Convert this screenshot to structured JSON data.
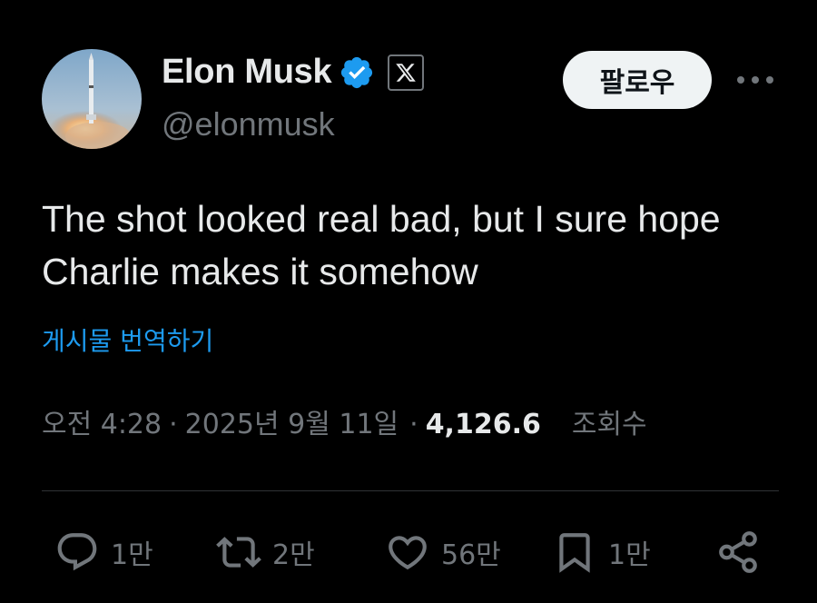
{
  "author": {
    "display_name": "Elon Musk",
    "handle": "@elonmusk",
    "verified_icon": "verified-badge-icon",
    "affiliation_icon": "x-logo-icon"
  },
  "header": {
    "follow_label": "팔로우",
    "more_icon": "more-horizontal-icon"
  },
  "tweet": {
    "text": "The shot looked real bad, but I sure hope Charlie makes it somehow",
    "translate_label": "게시물 번역하기"
  },
  "meta": {
    "time": "오전 4:28",
    "separator1": "·",
    "date": "2025년 9월 11일",
    "separator2": "·",
    "views_count": "4,126.6",
    "views_label": "조회수"
  },
  "actions": {
    "reply_count": "1만",
    "repost_count": "2만",
    "like_count": "56만",
    "bookmark_count": "1만"
  },
  "colors": {
    "background": "#000000",
    "text_primary": "#e7e9ea",
    "text_secondary": "#71767b",
    "accent_blue": "#1d9bf0",
    "divider": "#2f3336"
  }
}
